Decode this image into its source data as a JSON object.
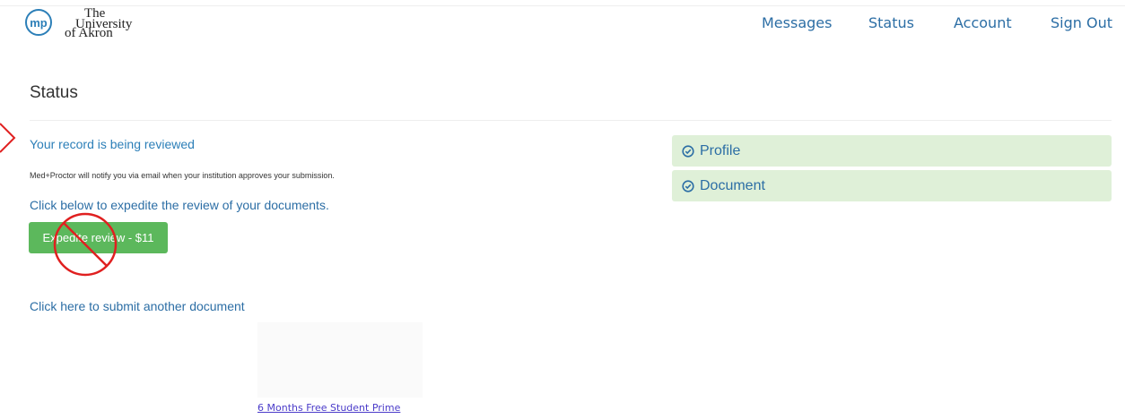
{
  "header": {
    "logo_text": "mp",
    "institution": {
      "line1": "The",
      "line2": "University",
      "line3": "of Akron"
    },
    "nav": [
      "Messages",
      "Status",
      "Account",
      "Sign Out"
    ]
  },
  "main": {
    "page_title": "Status",
    "record_status": "Your record is being reviewed",
    "notify_text": "Med+Proctor will notify you via email when your institution approves your submission.",
    "expedite_hint": "Click below to expedite the review of your documents.",
    "expedite_button": "Expedite review - $11",
    "submit_link": "Click here to submit another document",
    "promo_link": "6 Months Free Student Prime"
  },
  "checklist": [
    "Profile",
    "Document"
  ],
  "colors": {
    "link_blue": "#2c6ea5",
    "panel_green": "#dff0d8",
    "button_green": "#5cb85c",
    "annotation_red": "#e02020"
  },
  "icons": {
    "panel_icon": "check-circle-icon",
    "overlay_icon": "no-sign-icon",
    "pointer": "arrow-pointer-icon"
  }
}
